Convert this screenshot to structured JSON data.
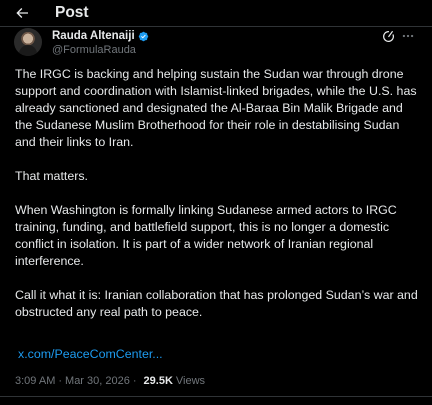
{
  "header": {
    "title": "Post"
  },
  "author": {
    "display_name": "Rauda Altenaiji",
    "handle": "@FormulaRauda",
    "verified": true,
    "verified_color": "#1d9bf0"
  },
  "tweet": {
    "paragraphs": [
      "The IRGC is backing and helping sustain the Sudan war through drone support and coordination with Islamist-linked brigades, while the U.S. has already sanctioned and designated the Al-Baraa Bin Malik Brigade and the Sudanese Muslim Brotherhood for their role in destabilising Sudan and their links to Iran.",
      "That matters.",
      "When Washington is formally linking Sudanese armed actors to IRGC training, funding, and battlefield support, this is no longer a domestic conflict in isolation. It is part of a wider network of Iranian regional interference.",
      "Call it what it is: Iranian collaboration that has prolonged Sudan’s war and obstructed any real path to peace."
    ],
    "link_text": "x.com/PeaceComCenter..."
  },
  "meta": {
    "time": "3:09 AM",
    "separator": "·",
    "date": "Mar 30, 2026",
    "views_count": "29.5K",
    "views_label": "Views"
  },
  "colors": {
    "background": "#000000",
    "text": "#e7e9ea",
    "muted": "#71767b",
    "link": "#1d9bf0",
    "border": "#2f3336"
  },
  "icons": {
    "back": "arrow-left-icon",
    "verified": "verified-badge-icon",
    "grok": "grok-icon",
    "more": "more-icon"
  }
}
